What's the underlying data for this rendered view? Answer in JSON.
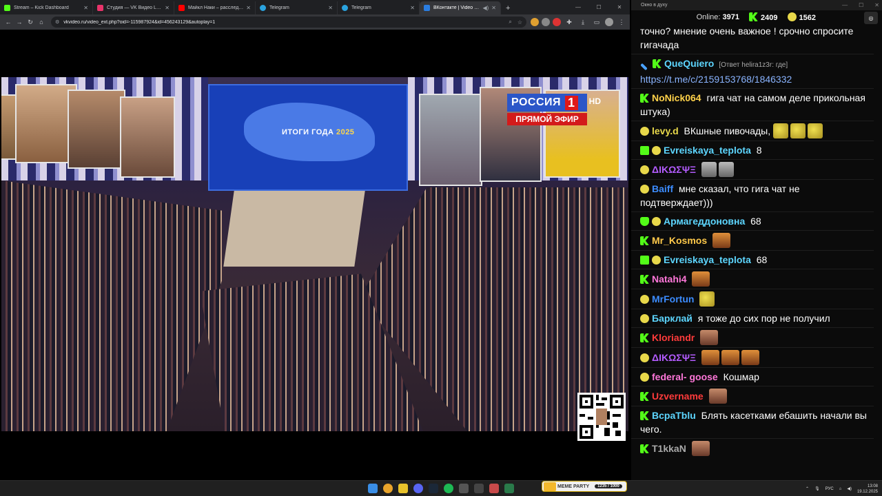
{
  "browser": {
    "tabs": [
      {
        "title": "Stream – Kick Dashboard",
        "icon": "kick-icon",
        "color": "#53fc18",
        "active": false
      },
      {
        "title": "Студия — VK Видео Live",
        "icon": "vk-video-icon",
        "color": "#e8336a",
        "active": false
      },
      {
        "title": "Майкл Наки – расследовани...",
        "icon": "youtube-icon",
        "color": "#ff0000",
        "active": false
      },
      {
        "title": "Telegram",
        "icon": "telegram-icon",
        "color": "#2aa3df",
        "active": false
      },
      {
        "title": "Telegram",
        "icon": "telegram-icon",
        "color": "#2aa3df",
        "active": false
      },
      {
        "title": "ВКонтакте | Video Ext",
        "icon": "vk-icon",
        "color": "#2a7de1",
        "active": true
      }
    ],
    "url": "vkvideo.ru/video_ext.php?oid=-115987924&id=456243129&autoplay=1"
  },
  "video": {
    "stage_title_main": "ИТОГИ ГОДА",
    "stage_title_year": "2025",
    "channel_name": "РОССИЯ",
    "channel_number": "1",
    "channel_hd": "HD",
    "live_label": "ПРЯМОЙ ЭФИР"
  },
  "chat": {
    "window_title": "Окно в духу",
    "online_label": "Online:",
    "online_count": "3971",
    "stat_green": "2409",
    "stat_gold": "1562",
    "messages": [
      {
        "user": "",
        "text": "точно? мнение очень важное ! срочно спросите гигачада"
      },
      {
        "user": "QueQuiero",
        "color": "#5dd6ff",
        "reply": "[Ответ helira1z3r: где]",
        "text": "https://t.me/c/2159153768/1846332"
      },
      {
        "user": "NoNick064",
        "color": "#ffd24a",
        "text": "гига чат на самом деле прикольная штука)"
      },
      {
        "user": "levy.d",
        "color": "#e8d84a",
        "text": "ВКшные пивочады,"
      },
      {
        "user": "Evreiskaya_teplota",
        "color": "#5dd6ff",
        "text": "8"
      },
      {
        "user": "ΔΙΚΩΣΨΞ",
        "color": "#b45cff",
        "text": ""
      },
      {
        "user": "Baiff",
        "color": "#3c8cff",
        "text": "мне сказал, что гига чат не подтверждает)))"
      },
      {
        "user": "Армагеддоновна",
        "color": "#5dd6ff",
        "text": "68"
      },
      {
        "user": "Mr_Kosmos",
        "color": "#ffc94a",
        "text": ""
      },
      {
        "user": "Evreiskaya_teplota",
        "color": "#5dd6ff",
        "text": "68"
      },
      {
        "user": "Natahi4",
        "color": "#ff77d9",
        "text": ""
      },
      {
        "user": "MrFortun",
        "color": "#3c8cff",
        "text": ""
      },
      {
        "user": "Барклай",
        "color": "#5dd6ff",
        "text": "я тоже до сих пор не получил"
      },
      {
        "user": "Kloriandr",
        "color": "#ff3b3b",
        "text": ""
      },
      {
        "user": "ΔΙΚΩΣΨΞ",
        "color": "#b45cff",
        "text": ""
      },
      {
        "user": "federal- goose",
        "color": "#ff77d9",
        "text": "Кошмар"
      },
      {
        "user": "Uzvername",
        "color": "#ff3b3b",
        "text": ""
      },
      {
        "user": "ВсраTblu",
        "color": "#5dd6ff",
        "text": "Блять касетками ебашить начали вы чего."
      },
      {
        "user": "T1kkaN",
        "color": "#aaaaaa",
        "text": ""
      }
    ]
  },
  "taskbar": {
    "meme_widget_label": "MEME PARTY",
    "meme_widget_count": "1235 / 1000",
    "lang": "РУС",
    "time": "13:08",
    "date": "19.12.2025"
  }
}
